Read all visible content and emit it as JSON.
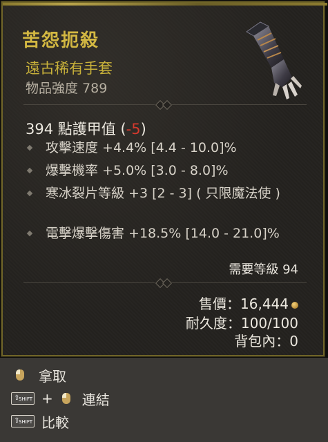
{
  "item": {
    "name": "苦怨扼殺",
    "type": "遠古稀有手套",
    "power_label": "物品強度 789"
  },
  "armor": {
    "text": "394 點護甲值",
    "open": "(",
    "delta": "-5",
    "close": ")"
  },
  "affixes": [
    "攻擊速度 +4.4% [4.4 - 10.0]%",
    "爆擊機率 +5.0% [3.0 - 8.0]%",
    "寒冰裂片等級 +3 [2 - 3] ( 只限魔法使 )",
    "電擊爆擊傷害 +18.5% [14.0 - 21.0]%"
  ],
  "requirements": {
    "level": "需要等級 94"
  },
  "stats": {
    "sell": "售價：16,444",
    "durability": "耐久度：100/100",
    "stash": "背包內：0"
  },
  "hints": {
    "pickup": "拿取",
    "link": "連結",
    "compare": "比較",
    "plus": "+",
    "shift": "SHIFT"
  },
  "colors": {
    "title": "#d3b842",
    "rarity": "#c8b13a",
    "negative": "#d6392d",
    "border": "#6f6428"
  },
  "icons": [
    "gauntlet-icon",
    "coin-icon",
    "mouse-left-icon",
    "shift-key-icon"
  ]
}
